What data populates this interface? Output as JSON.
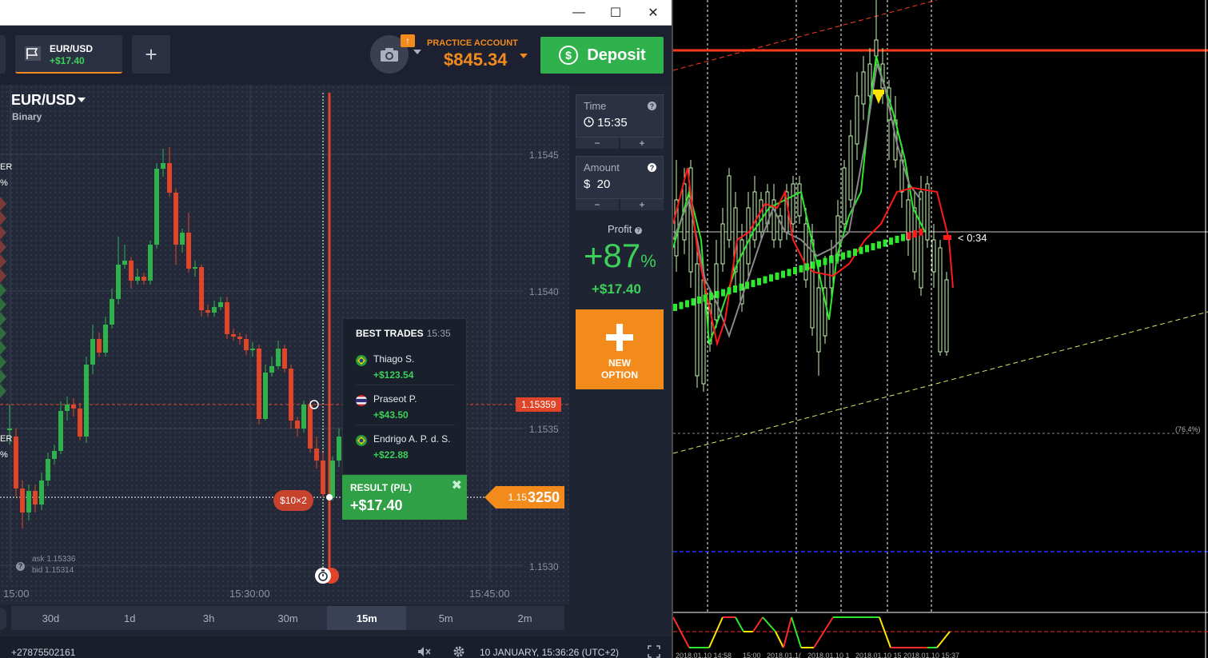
{
  "window": {
    "minimize": "—",
    "maximize": "☐",
    "close": "✕"
  },
  "topbar": {
    "asset_tab": {
      "name": "EUR/USD",
      "pl": "+$17.40"
    },
    "add_tab": "+",
    "notification": "↑",
    "account_label": "PRACTICE ACCOUNT",
    "balance": "$845.34",
    "deposit_label": "Deposit"
  },
  "chart": {
    "asset": "EUR/USD",
    "type": "Binary",
    "y_ticks": [
      "1.1545",
      "1.1540",
      "1.1535",
      "1.1530"
    ],
    "x_ticks": [
      "15:00",
      "15:30:00",
      "15:45:00"
    ],
    "ask": "ask 1.15336",
    "bid": "bid 1.15314",
    "strike_price": "1.15359",
    "current_price_prefix": "1.15",
    "current_price_suffix": "3250",
    "bet_badge": "$10×2",
    "left_cut_labels": [
      "ER",
      "%",
      "ER",
      "%"
    ]
  },
  "best_trades": {
    "title": "BEST TRADES",
    "time": "15:35",
    "rows": [
      {
        "name": "Thiago S.",
        "amount": "+$123.54"
      },
      {
        "name": "Praseot P.",
        "amount": "+$43.50"
      },
      {
        "name": "Endrigo A. P. d. S.",
        "amount": "+$22.88"
      }
    ]
  },
  "result": {
    "label": "RESULT (P/L)",
    "value": "+$17.40",
    "close": "✖"
  },
  "side": {
    "time_label": "Time",
    "time_value": "15:35",
    "amount_label": "Amount",
    "amount_value": "$  20",
    "minus": "−",
    "plus": "+",
    "help": "?",
    "profit_label": "Profit",
    "profit_pct": "+87",
    "profit_pct_sign": "%",
    "profit_value": "+$17.40",
    "new_option": "NEW OPTION"
  },
  "timeframes": [
    "30d",
    "1d",
    "3h",
    "30m",
    "15m",
    "5m",
    "2m"
  ],
  "timeframe_active": "15m",
  "footer": {
    "phone": "+27875502161",
    "clock": "10 JANUARY, 15:36:26",
    "tz": "(UTC+2)"
  },
  "mt": {
    "countdown": "< 0:34",
    "fib_label": "(76.4%)",
    "time_labels": [
      "2018.01.10 14:58",
      "15:00",
      "2018.01.1(",
      "2018.01.10 1",
      "2018.01.10 15",
      "2018.01.10 15:37"
    ]
  },
  "colors": {
    "accent": "#f28b1c",
    "green": "#2fb24c",
    "red": "#e0452a",
    "bg": "#232938"
  }
}
